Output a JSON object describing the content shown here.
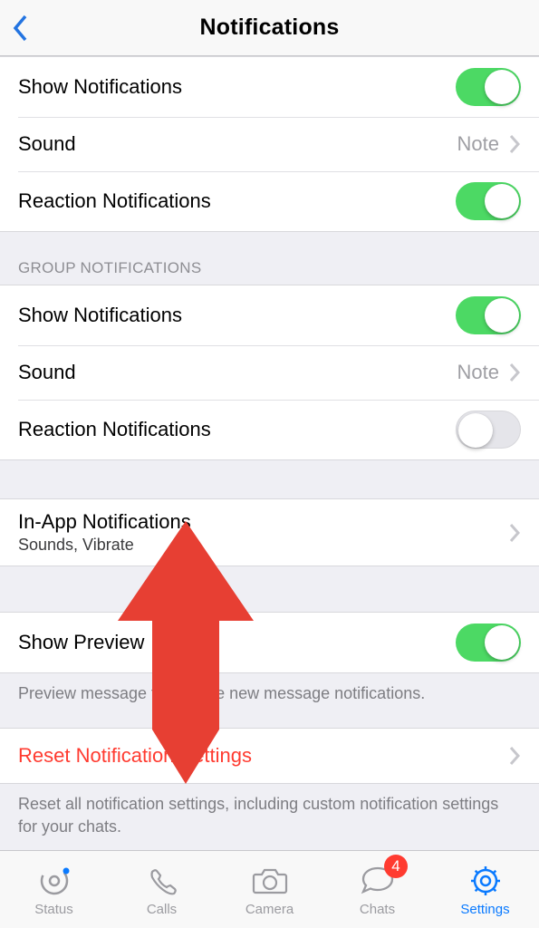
{
  "header": {
    "title": "Notifications"
  },
  "message_section": {
    "show_notifications": {
      "label": "Show Notifications",
      "on": true
    },
    "sound": {
      "label": "Sound",
      "value": "Note"
    },
    "reaction_notifications": {
      "label": "Reaction Notifications",
      "on": true
    }
  },
  "group_section": {
    "header": "GROUP NOTIFICATIONS",
    "show_notifications": {
      "label": "Show Notifications",
      "on": true
    },
    "sound": {
      "label": "Sound",
      "value": "Note"
    },
    "reaction_notifications": {
      "label": "Reaction Notifications",
      "on": false
    }
  },
  "in_app": {
    "label": "In-App Notifications",
    "subtitle": "Sounds, Vibrate"
  },
  "show_preview": {
    "label": "Show Preview",
    "on": true,
    "footer": "Preview message text inside new message notifications."
  },
  "reset": {
    "label": "Reset Notification Settings",
    "footer": "Reset all notification settings, including custom notification settings for your chats."
  },
  "tabs": {
    "status": "Status",
    "calls": "Calls",
    "camera": "Camera",
    "chats": "Chats",
    "chats_badge": "4",
    "settings": "Settings"
  },
  "colors": {
    "accent": "#0a7aff",
    "toggle_on": "#4cd964",
    "danger": "#ff3b30",
    "arrow": "#e73f33"
  }
}
